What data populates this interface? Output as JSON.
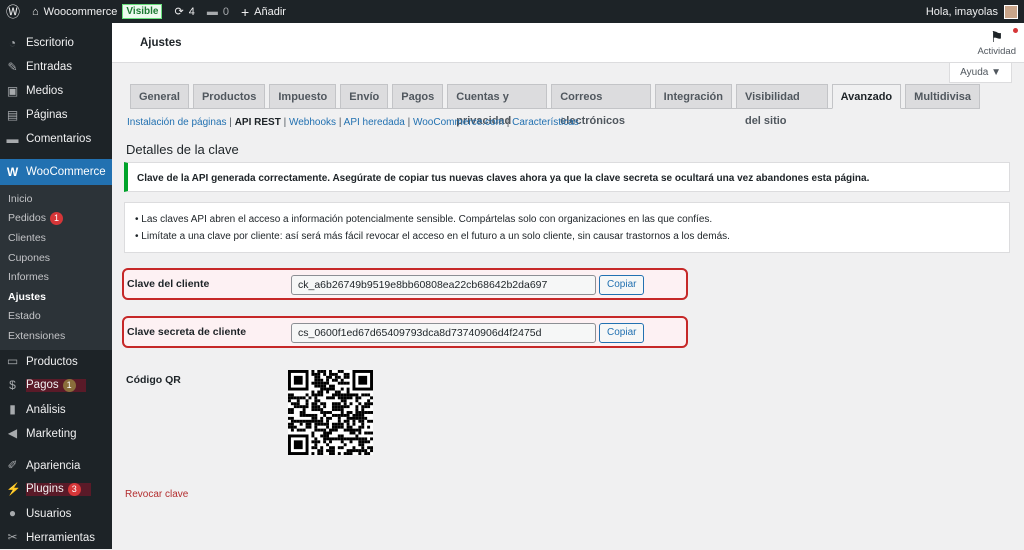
{
  "adminbar": {
    "site": "Woocommerce",
    "visible_badge": "Visible",
    "updates": "4",
    "comments": "0",
    "add_new": "Añadir",
    "greeting": "Hola, imayolas"
  },
  "sidebar": {
    "items_top": [
      {
        "label": "Escritorio",
        "icon": "◔"
      },
      {
        "label": "Entradas",
        "icon": "✎"
      },
      {
        "label": "Medios",
        "icon": "▣"
      },
      {
        "label": "Páginas",
        "icon": "▤"
      },
      {
        "label": "Comentarios",
        "icon": "▬"
      }
    ],
    "woocommerce": "WooCommerce",
    "submenu": [
      {
        "label": "Inicio"
      },
      {
        "label": "Pedidos",
        "count": "1"
      },
      {
        "label": "Clientes"
      },
      {
        "label": "Cupones"
      },
      {
        "label": "Informes"
      },
      {
        "label": "Ajustes"
      },
      {
        "label": "Estado"
      },
      {
        "label": "Extensiones"
      }
    ],
    "items_bottom": [
      {
        "label": "Productos",
        "icon": "▭"
      },
      {
        "label": "Pagos",
        "icon": "$",
        "count": "1"
      },
      {
        "label": "Análisis",
        "icon": "▮"
      },
      {
        "label": "Marketing",
        "icon": "◀"
      },
      {
        "label": "Apariencia",
        "icon": "✐"
      },
      {
        "label": "Plugins",
        "icon": "⚡",
        "count": "3"
      },
      {
        "label": "Usuarios",
        "icon": "●"
      },
      {
        "label": "Herramientas",
        "icon": "✂"
      }
    ]
  },
  "header": {
    "title": "Ajustes",
    "activity": "Actividad"
  },
  "help": "Ayuda ▼",
  "tabs": [
    "General",
    "Productos",
    "Impuesto",
    "Envío",
    "Pagos",
    "Cuentas y privacidad",
    "Correos electrónicos",
    "Integración",
    "Visibilidad del sitio",
    "Avanzado",
    "Multidivisa"
  ],
  "subnav": {
    "links": [
      "Instalación de páginas",
      "API REST",
      "Webhooks",
      "API heredada",
      "WooCommerce.com",
      "Características"
    ]
  },
  "section_title": "Detalles de la clave",
  "success_notice": "Clave de la API generada correctamente. Asegúrate de copiar tus nuevas claves ahora ya que la clave secreta se ocultará una vez abandones esta página.",
  "info": [
    "Las claves API abren el acceso a información potencialmente sensible. Compártelas solo con organizaciones en las que confíes.",
    "Limítate a una clave por cliente: así será más fácil revocar el acceso en el futuro a un solo cliente, sin causar trastornos a los demás."
  ],
  "consumer_key": {
    "label": "Clave del cliente",
    "value": "ck_a6b26749b9519e8bb60808ea22cb68642b2da697",
    "button": "Copiar"
  },
  "consumer_secret": {
    "label": "Clave secreta de cliente",
    "value": "cs_0600f1ed67d65409793dca8d73740906d4f2475d",
    "button": "Copiar"
  },
  "qr_label": "Código QR",
  "revoke": "Revocar clave"
}
